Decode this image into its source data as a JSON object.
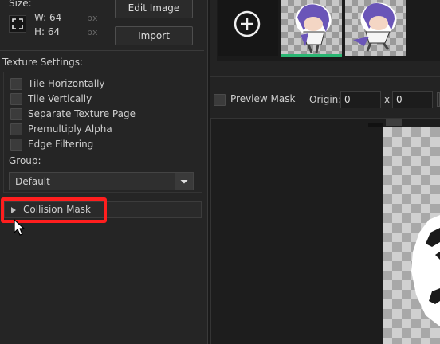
{
  "size": {
    "label": "Size:",
    "width_label": "W: 64",
    "height_label": "H: 64",
    "width_unit": "px",
    "height_unit": "px"
  },
  "buttons": {
    "edit_image": "Edit Image",
    "import": "Import"
  },
  "texture_settings": {
    "label": "Texture Settings:",
    "options": [
      {
        "label": "Tile Horizontally",
        "checked": false
      },
      {
        "label": "Tile Vertically",
        "checked": false
      },
      {
        "label": "Separate Texture Page",
        "checked": false
      },
      {
        "label": "Premultiply Alpha",
        "checked": false
      },
      {
        "label": "Edge Filtering",
        "checked": false
      }
    ],
    "group_label": "Group:",
    "group_value": "Default"
  },
  "collision_mask": {
    "label": "Collision Mask",
    "expanded": false
  },
  "mask_bar": {
    "preview_mask_label": "Preview Mask",
    "preview_mask_checked": false,
    "origin_label": "Origin:",
    "origin_x": "0",
    "x_sep": "x",
    "origin_y": "0"
  },
  "colors": {
    "highlight": "#ff1e1e",
    "selected_frame_underline": "#2bb673"
  },
  "icons": {
    "size_icon": "expand-arrows-icon",
    "add_frame": "plus-circle-icon",
    "dropdown": "chevron-down-icon",
    "collapse": "triangle-right-icon",
    "cursor": "mouse-pointer-icon"
  }
}
